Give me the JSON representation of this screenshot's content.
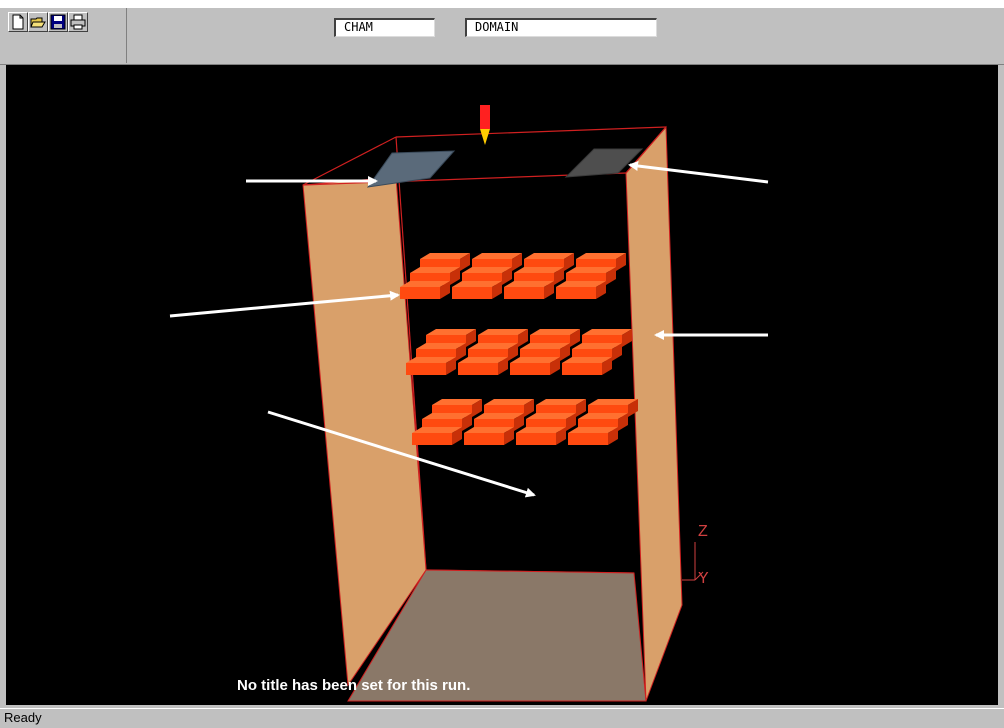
{
  "toolbar": {
    "buttons": [
      {
        "name": "new-file-icon"
      },
      {
        "name": "open-folder-icon"
      },
      {
        "name": "save-disk-icon"
      },
      {
        "name": "print-icon"
      }
    ],
    "field1": "CHAM",
    "field2": "DOMAIN"
  },
  "viewport": {
    "run_title": "No title has been set for this run.",
    "axis": {
      "z": "Z",
      "y": "Y"
    },
    "colors": {
      "background": "#000000",
      "walls": "#d9a06a",
      "floor": "#8a7868",
      "blocks": "#ff4a10",
      "edges": "#d02020",
      "vents": "#5a6a7a",
      "arrows": "#ffffff"
    }
  },
  "status": {
    "text": "Ready"
  }
}
